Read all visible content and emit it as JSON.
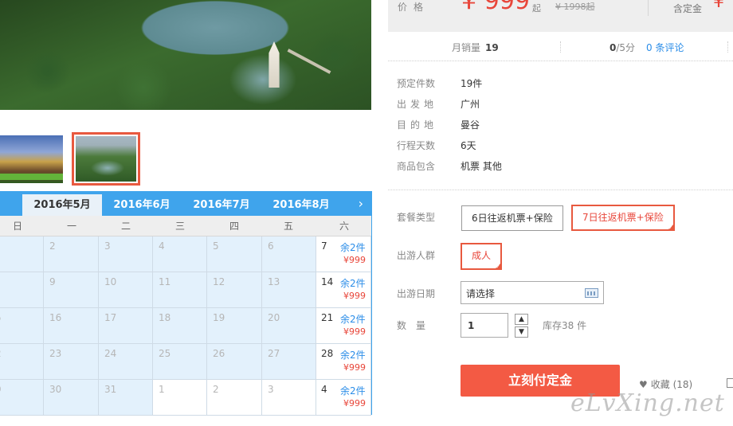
{
  "gallery": {
    "main_image_alt": "Aerial view of lake park",
    "thumbnails": [
      {
        "name": "thumb-temple"
      },
      {
        "name": "thumb-lake",
        "selected": true
      }
    ]
  },
  "calendar": {
    "months": [
      "2016年5月",
      "2016年6月",
      "2016年7月",
      "2016年8月"
    ],
    "active_month": "2016年5月",
    "next_icon": "chevron-right-icon",
    "next_glyph": "›",
    "weekdays": [
      "日",
      "一",
      "二",
      "三",
      "四",
      "五",
      "六"
    ],
    "rows": [
      {
        "days": [
          "",
          "2",
          "3",
          "4",
          "5",
          "6"
        ],
        "sat": {
          "day": "7",
          "stock": "余2件",
          "price": "¥999"
        }
      },
      {
        "days": [
          "",
          "9",
          "10",
          "11",
          "12",
          "13"
        ],
        "sat": {
          "day": "14",
          "stock": "余2件",
          "price": "¥999"
        }
      },
      {
        "days": [
          "5",
          "16",
          "17",
          "18",
          "19",
          "20"
        ],
        "sat": {
          "day": "21",
          "stock": "余2件",
          "price": "¥999"
        }
      },
      {
        "days": [
          "2",
          "23",
          "24",
          "25",
          "26",
          "27"
        ],
        "sat": {
          "day": "28",
          "stock": "余2件",
          "price": "¥999"
        }
      },
      {
        "days": [
          "9",
          "30",
          "31",
          "1",
          "2",
          "3"
        ],
        "sat": {
          "day": "4",
          "stock": "余2件",
          "price": "¥999"
        }
      }
    ]
  },
  "price": {
    "label": "价格",
    "currency": "¥",
    "value": "999",
    "qi": "起",
    "old_price": "¥ 1998起",
    "deposit_label": "含定金",
    "deposit_value": "¥"
  },
  "stats": {
    "sales_label": "月销量",
    "sales_value": "19",
    "score_value": "0",
    "score_suffix": "/5分",
    "reviews": "0 条评论"
  },
  "details": [
    {
      "key": "预定件数",
      "value": "19件"
    },
    {
      "key": "出发地",
      "value": "广州"
    },
    {
      "key": "目的地",
      "value": "曼谷"
    },
    {
      "key": "行程天数",
      "value": "6天"
    },
    {
      "key": "商品包含",
      "value": "机票  其他"
    }
  ],
  "options": {
    "package_label": "套餐类型",
    "package_choices": [
      "6日往返机票+保险",
      "7日往返机票+保险"
    ],
    "package_selected": "7日往返机票+保险",
    "traveler_label": "出游人群",
    "traveler_choice": "成人",
    "date_label": "出游日期",
    "date_placeholder": "请选择",
    "qty_label": "数量",
    "qty_value": "1",
    "stock_text": "库存38 件"
  },
  "actions": {
    "buy_label": "立刻付定金",
    "fav_label": "收藏 (18)"
  },
  "watermark": "eLvXing.net",
  "colors": {
    "accent_orange": "#f35a44",
    "calendar_blue": "#3fa4ec",
    "link_blue": "#2b8de8",
    "price_red": "#e8463a"
  }
}
